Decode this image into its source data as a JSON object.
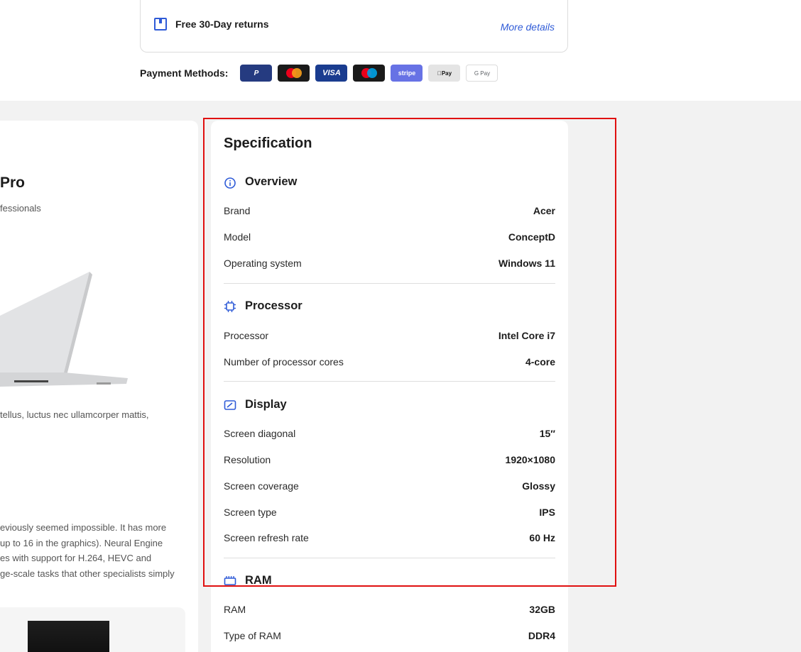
{
  "delivery": {
    "returns_label": "Free 30-Day returns",
    "more_details": "More details"
  },
  "payment": {
    "label": "Payment Methods:",
    "methods": [
      {
        "name": "PayPal",
        "text": "P"
      },
      {
        "name": "Mastercard",
        "text": ""
      },
      {
        "name": "Visa",
        "text": "VISA"
      },
      {
        "name": "Maestro",
        "text": ""
      },
      {
        "name": "Stripe",
        "text": "stripe"
      },
      {
        "name": "Apple Pay",
        "text": "Pay"
      },
      {
        "name": "Google Pay",
        "text": "G Pay"
      }
    ]
  },
  "product": {
    "title_fragment": "Pro",
    "subtitle_fragment": "fessionals",
    "desc_fragment": " tellus, luctus nec ullamcorper mattis,",
    "long_lines": [
      "eviously seemed impossible. It has more",
      " up to 16 in the graphics). Neural Engine",
      "es with support for H.264, HEVC and",
      "ge-scale tasks that other specialists simply"
    ]
  },
  "spec": {
    "heading": "Specification",
    "sections": {
      "overview": {
        "title": "Overview",
        "rows": [
          {
            "label": "Brand",
            "value": "Acer"
          },
          {
            "label": "Model",
            "value": "ConceptD"
          },
          {
            "label": "Operating system",
            "value": "Windows 11"
          }
        ]
      },
      "processor": {
        "title": "Processor",
        "rows": [
          {
            "label": "Processor",
            "value": "Intel Core i7"
          },
          {
            "label": "Number of processor cores",
            "value": "4-core"
          }
        ]
      },
      "display": {
        "title": "Display",
        "rows": [
          {
            "label": "Screen diagonal",
            "value": "15″"
          },
          {
            "label": "Resolution",
            "value": "1920×1080"
          },
          {
            "label": "Screen coverage",
            "value": "Glossy"
          },
          {
            "label": "Screen type",
            "value": "IPS"
          },
          {
            "label": "Screen refresh rate",
            "value": "60 Hz"
          }
        ]
      },
      "ram": {
        "title": "RAM",
        "rows": [
          {
            "label": "RAM",
            "value": "32GB"
          },
          {
            "label": "Type of RAM",
            "value": "DDR4"
          }
        ]
      }
    }
  },
  "colors": {
    "accent": "#2f5bd7",
    "highlight": "#e01010",
    "page_bg": "#f2f2f2"
  }
}
